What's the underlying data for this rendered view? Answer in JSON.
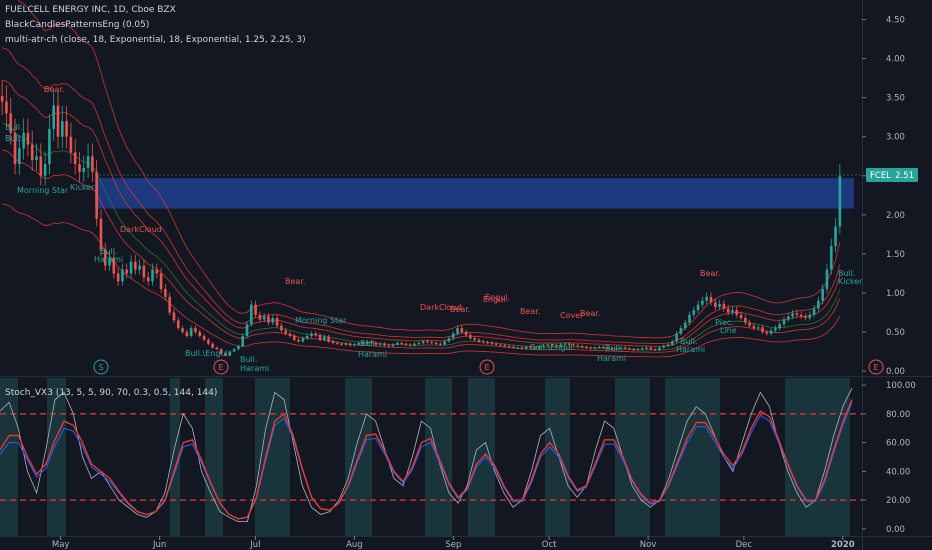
{
  "header": {
    "symbol_line": "FUELCELL ENERGY INC, 1D, Cboe BZX",
    "indicator_1": "BlackCandlesPatternsEng (0.05)",
    "indicator_2": "multi-atr-ch (close, 18, Exponential, 18, Exponential, 1.25, 2.25, 3)",
    "sub_indicator": "Stoch_VX3 (13, 5, 5, 90, 70, 0.3, 0.5, 144, 144)"
  },
  "price_tag": {
    "symbol": "FCEL",
    "value": "2.51"
  },
  "colors": {
    "background": "#131722",
    "bull": "#26a69a",
    "bear": "#ef5350",
    "zone": "#1f3f8f",
    "tag": "#26a69a",
    "stoch_fast": "#b2b5be",
    "stoch_slow": "#e53935",
    "stoch_blue": "#2962ff",
    "band_red": "#e53935",
    "band_green": "#2e7d32",
    "shade": "#1b3a3f",
    "dashed": "#e53935"
  },
  "chart_data": [
    {
      "type": "candlestick",
      "y_ticks": [
        "4.50",
        "4.00",
        "3.50",
        "3.00",
        "2.50",
        "2.00",
        "1.50",
        "1.00",
        "0.50",
        "0.00"
      ],
      "ylim": [
        -0.05,
        4.75
      ],
      "x_ticks": [
        "May",
        "Jun",
        "Jul",
        "Aug",
        "Sep",
        "Oct",
        "Nov",
        "Dec",
        "2020"
      ],
      "x_range": [
        "2019-04-12",
        "2020-01-07"
      ],
      "horizontal_zone": [
        2.08,
        2.47
      ],
      "last_price": 2.51,
      "closes": [
        3.45,
        3.3,
        3.05,
        2.65,
        2.85,
        3.05,
        2.9,
        2.7,
        2.75,
        2.5,
        2.65,
        3.1,
        3.4,
        3.0,
        3.2,
        3.0,
        2.8,
        2.65,
        2.55,
        2.6,
        2.75,
        2.55,
        1.95,
        1.55,
        1.35,
        1.45,
        1.25,
        1.15,
        1.3,
        1.25,
        1.4,
        1.3,
        1.35,
        1.2,
        1.15,
        1.3,
        1.25,
        1.05,
        0.95,
        0.75,
        0.65,
        0.55,
        0.5,
        0.45,
        0.55,
        0.5,
        0.45,
        0.4,
        0.35,
        0.3,
        0.28,
        0.22,
        0.2,
        0.25,
        0.28,
        0.32,
        0.45,
        0.6,
        0.85,
        0.72,
        0.66,
        0.7,
        0.62,
        0.68,
        0.58,
        0.52,
        0.48,
        0.45,
        0.4,
        0.38,
        0.42,
        0.45,
        0.48,
        0.46,
        0.4,
        0.44,
        0.38,
        0.36,
        0.35,
        0.34,
        0.35,
        0.33,
        0.34,
        0.36,
        0.35,
        0.38,
        0.36,
        0.34,
        0.35,
        0.33,
        0.32,
        0.34,
        0.36,
        0.35,
        0.34,
        0.33,
        0.35,
        0.36,
        0.38,
        0.37,
        0.36,
        0.35,
        0.34,
        0.38,
        0.42,
        0.48,
        0.55,
        0.5,
        0.46,
        0.42,
        0.4,
        0.38,
        0.37,
        0.36,
        0.35,
        0.34,
        0.33,
        0.32,
        0.31,
        0.3,
        0.3,
        0.29,
        0.31,
        0.3,
        0.29,
        0.32,
        0.33,
        0.34,
        0.33,
        0.32,
        0.34,
        0.35,
        0.34,
        0.33,
        0.32,
        0.31,
        0.3,
        0.29,
        0.3,
        0.31,
        0.3,
        0.29,
        0.28,
        0.29,
        0.3,
        0.29,
        0.28,
        0.27,
        0.28,
        0.29,
        0.3,
        0.28,
        0.27,
        0.3,
        0.32,
        0.34,
        0.38,
        0.48,
        0.55,
        0.62,
        0.72,
        0.78,
        0.85,
        0.9,
        0.95,
        0.88,
        0.82,
        0.86,
        0.8,
        0.75,
        0.78,
        0.72,
        0.68,
        0.62,
        0.58,
        0.55,
        0.56,
        0.5,
        0.48,
        0.52,
        0.55,
        0.6,
        0.66,
        0.7,
        0.74,
        0.72,
        0.7,
        0.68,
        0.72,
        0.8,
        0.9,
        1.05,
        1.3,
        1.6,
        1.85,
        2.5
      ],
      "pattern_labels": [
        {
          "text": "Bull.",
          "kind": "bull"
        },
        {
          "text": "Harami",
          "kind": "bull"
        },
        {
          "text": "Morning Star",
          "kind": "bull"
        },
        {
          "text": "Kicker",
          "kind": "bull"
        },
        {
          "text": "Bear.",
          "kind": "bear"
        },
        {
          "text": "DarkCloud",
          "kind": "bear"
        },
        {
          "text": "Bull.\\Engul.",
          "kind": "bull"
        },
        {
          "text": "Engul.",
          "kind": "bear"
        },
        {
          "text": "Piec.",
          "kind": "bull"
        },
        {
          "text": "Line",
          "kind": "bull"
        },
        {
          "text": "Cover",
          "kind": "bear"
        }
      ],
      "event_markers": [
        "S",
        "E",
        "E",
        "E"
      ]
    },
    {
      "type": "line",
      "name": "Stoch_VX3",
      "y_ticks": [
        "100.00",
        "80.00",
        "60.00",
        "40.00",
        "20.00",
        "0.00"
      ],
      "ylim": [
        -5,
        105
      ],
      "levels": [
        80,
        20
      ],
      "series_fast": [
        82,
        88,
        70,
        40,
        25,
        55,
        90,
        95,
        80,
        50,
        35,
        40,
        30,
        20,
        15,
        10,
        8,
        12,
        25,
        55,
        80,
        70,
        40,
        25,
        12,
        8,
        5,
        5,
        30,
        70,
        95,
        90,
        60,
        30,
        15,
        10,
        12,
        20,
        35,
        60,
        80,
        75,
        55,
        35,
        30,
        50,
        75,
        70,
        45,
        25,
        18,
        30,
        55,
        60,
        40,
        25,
        15,
        20,
        40,
        65,
        70,
        50,
        30,
        22,
        30,
        55,
        75,
        70,
        50,
        30,
        20,
        15,
        20,
        35,
        55,
        75,
        85,
        80,
        65,
        50,
        40,
        60,
        80,
        95,
        85,
        60,
        40,
        25,
        15,
        20,
        40,
        65,
        85,
        98
      ],
      "series_slow": [
        55,
        65,
        65,
        50,
        38,
        45,
        62,
        75,
        72,
        60,
        45,
        40,
        35,
        26,
        18,
        12,
        10,
        12,
        20,
        40,
        60,
        62,
        48,
        32,
        18,
        10,
        7,
        8,
        22,
        50,
        75,
        80,
        65,
        42,
        22,
        14,
        13,
        18,
        30,
        48,
        65,
        66,
        54,
        40,
        33,
        43,
        60,
        63,
        48,
        32,
        22,
        28,
        45,
        52,
        44,
        30,
        20,
        20,
        34,
        52,
        60,
        52,
        37,
        27,
        30,
        46,
        62,
        62,
        50,
        34,
        24,
        18,
        20,
        31,
        47,
        63,
        74,
        74,
        64,
        52,
        44,
        54,
        70,
        82,
        78,
        62,
        45,
        30,
        20,
        20,
        34,
        55,
        74,
        90
      ],
      "series_blue": [
        52,
        60,
        60,
        48,
        36,
        42,
        58,
        70,
        68,
        57,
        43,
        38,
        33,
        25,
        17,
        12,
        10,
        12,
        19,
        38,
        57,
        59,
        46,
        31,
        18,
        10,
        7,
        8,
        21,
        48,
        72,
        77,
        63,
        41,
        22,
        14,
        13,
        18,
        29,
        46,
        62,
        63,
        52,
        39,
        32,
        41,
        57,
        60,
        46,
        31,
        21,
        27,
        43,
        50,
        42,
        29,
        19,
        19,
        32,
        50,
        57,
        50,
        36,
        26,
        29,
        44,
        59,
        59,
        48,
        33,
        23,
        17,
        19,
        30,
        45,
        60,
        71,
        71,
        61,
        50,
        42,
        52,
        67,
        79,
        75,
        60,
        44,
        29,
        19,
        19,
        32,
        53,
        72,
        88
      ]
    }
  ]
}
